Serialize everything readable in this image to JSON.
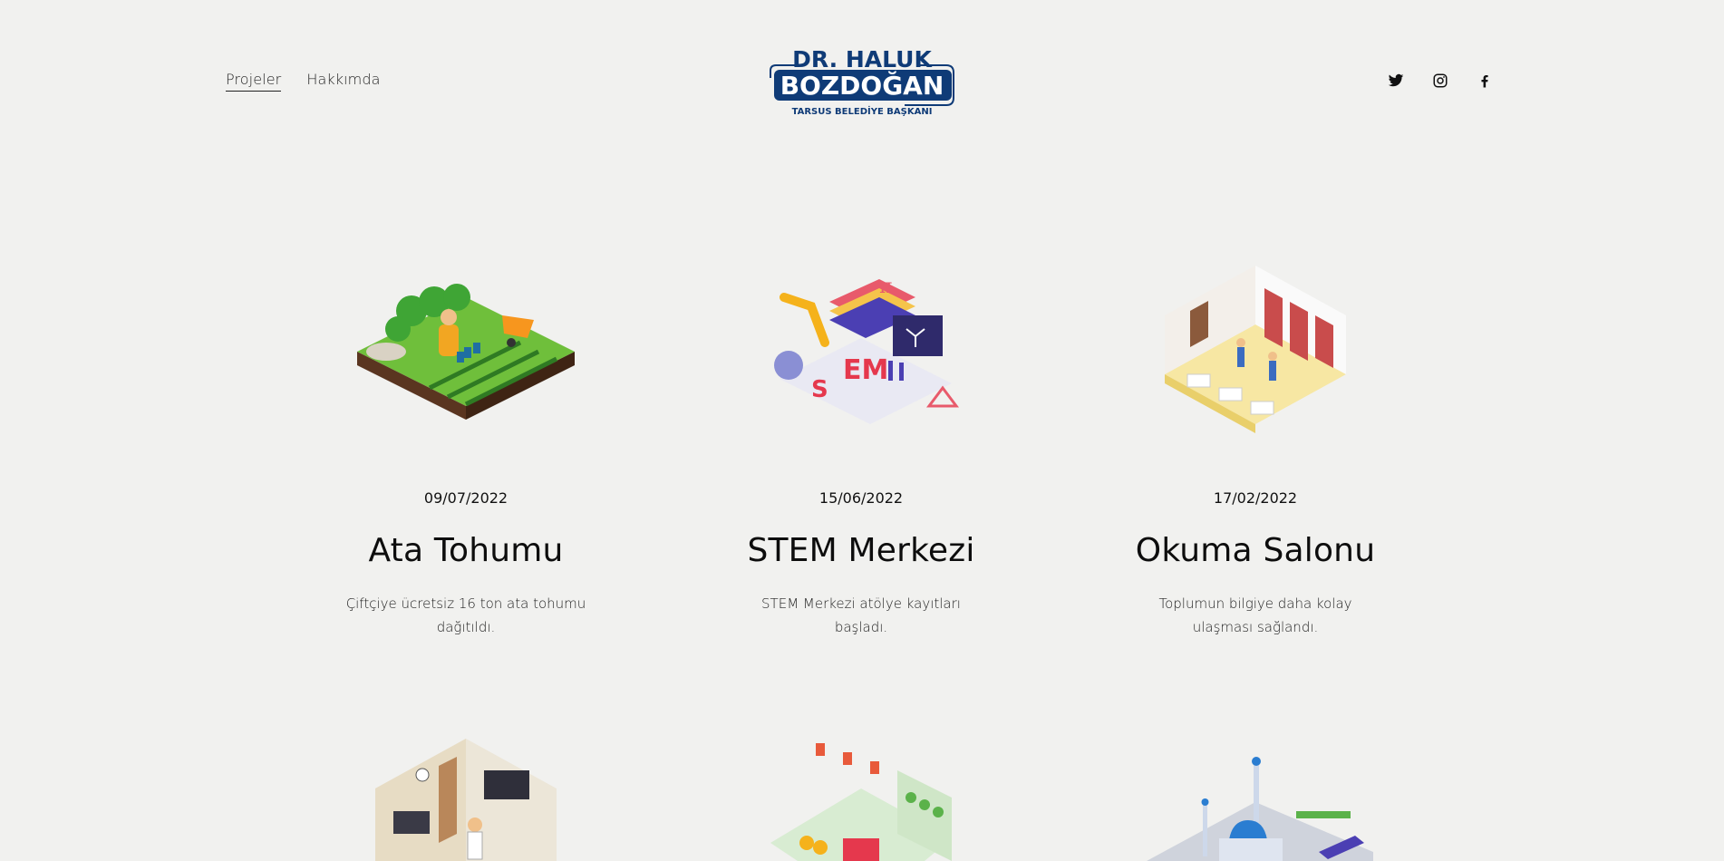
{
  "header": {
    "nav": [
      {
        "label": "Projeler",
        "active": true
      },
      {
        "label": "Hakkımda",
        "active": false
      }
    ],
    "logo": {
      "line1": "DR. HALUK",
      "line2": "BOZDOĞAN",
      "line3": "TARSUS BELEDİYE BAŞKANI"
    },
    "social": [
      "twitter-icon",
      "instagram-icon",
      "facebook-icon"
    ]
  },
  "projects": [
    {
      "date": "09/07/2022",
      "title": "Ata Tohumu",
      "description": "Çiftçiye ücretsiz 16 ton ata tohumu dağıtıldı."
    },
    {
      "date": "15/06/2022",
      "title": "STEM Merkezi",
      "description": "STEM Merkezi atölye kayıtları başladı."
    },
    {
      "date": "17/02/2022",
      "title": "Okuma Salonu",
      "description": "Toplumun bilgiye daha kolay ulaşması sağlandı."
    }
  ],
  "colors": {
    "brand": "#0f3b77",
    "background": "#f1f1ef"
  }
}
